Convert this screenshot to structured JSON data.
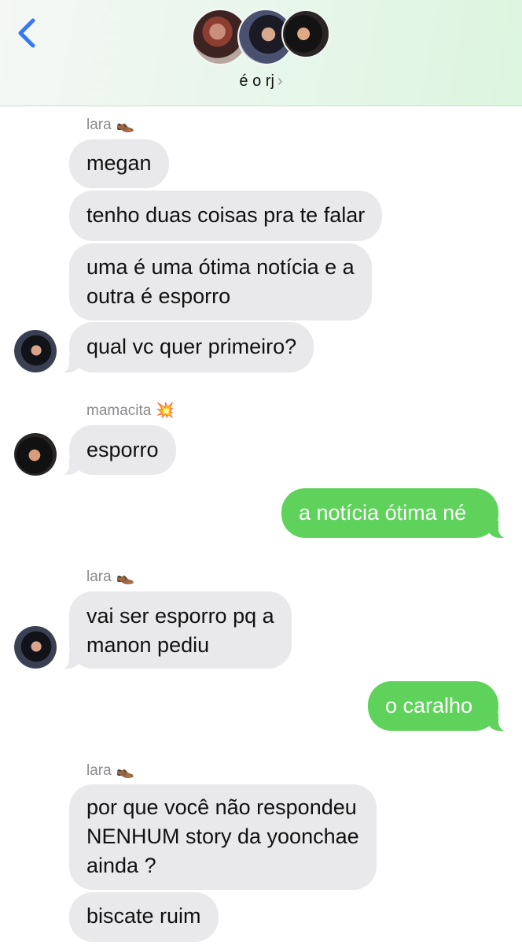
{
  "header": {
    "group_name": "é o rj",
    "chevron": "›",
    "back_icon": "chevron-left-icon",
    "accent": "#3478f6"
  },
  "colors": {
    "received": "#e9e9eb",
    "sent": "#5fd25b"
  },
  "messages": [
    {
      "sender_label": "lara",
      "sender_emoji": "👞"
    },
    {
      "text": "megan"
    },
    {
      "text": "tenho duas coisas pra te falar"
    },
    {
      "line1": "uma é uma ótima notícia e a",
      "line2": "outra é esporro"
    },
    {
      "text": "qual vc quer primeiro?"
    },
    {
      "sender_label": "mamacita",
      "sender_emoji": "💥"
    },
    {
      "text": "esporro"
    },
    {
      "text": "a notícia ótima né"
    },
    {
      "sender_label": "lara",
      "sender_emoji": "👞"
    },
    {
      "line1": "vai ser esporro pq a",
      "line2": "manon pediu"
    },
    {
      "text": "o caralho"
    },
    {
      "sender_label": "lara",
      "sender_emoji": "👞"
    },
    {
      "line1": "por que você não respondeu",
      "line2": "NENHUM story da yoonchae",
      "line3": "ainda ?"
    },
    {
      "text": "biscate ruim"
    }
  ]
}
